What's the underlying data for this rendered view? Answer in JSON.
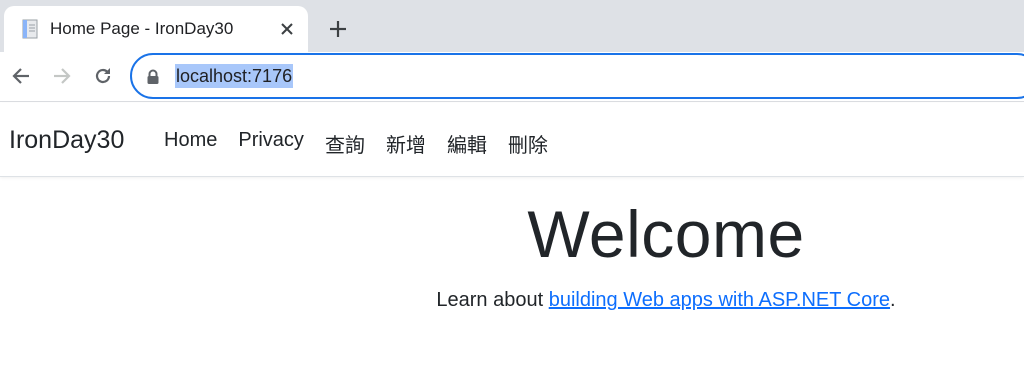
{
  "browser": {
    "tab": {
      "title": "Home Page - IronDay30"
    },
    "address_bar": {
      "url": "localhost:7176"
    }
  },
  "site": {
    "brand": "IronDay30",
    "nav": [
      {
        "label": "Home"
      },
      {
        "label": "Privacy"
      },
      {
        "label": "查詢"
      },
      {
        "label": "新增"
      },
      {
        "label": "編輯"
      },
      {
        "label": "刪除"
      }
    ]
  },
  "main": {
    "heading": "Welcome",
    "learn_prefix": "Learn about ",
    "learn_link": "building Web apps with ASP.NET Core",
    "learn_suffix": "."
  },
  "colors": {
    "tabstrip": "#dee1e6",
    "focus_ring": "#1a73e8",
    "selection": "#a8c7fa",
    "link": "#0d6efd"
  }
}
